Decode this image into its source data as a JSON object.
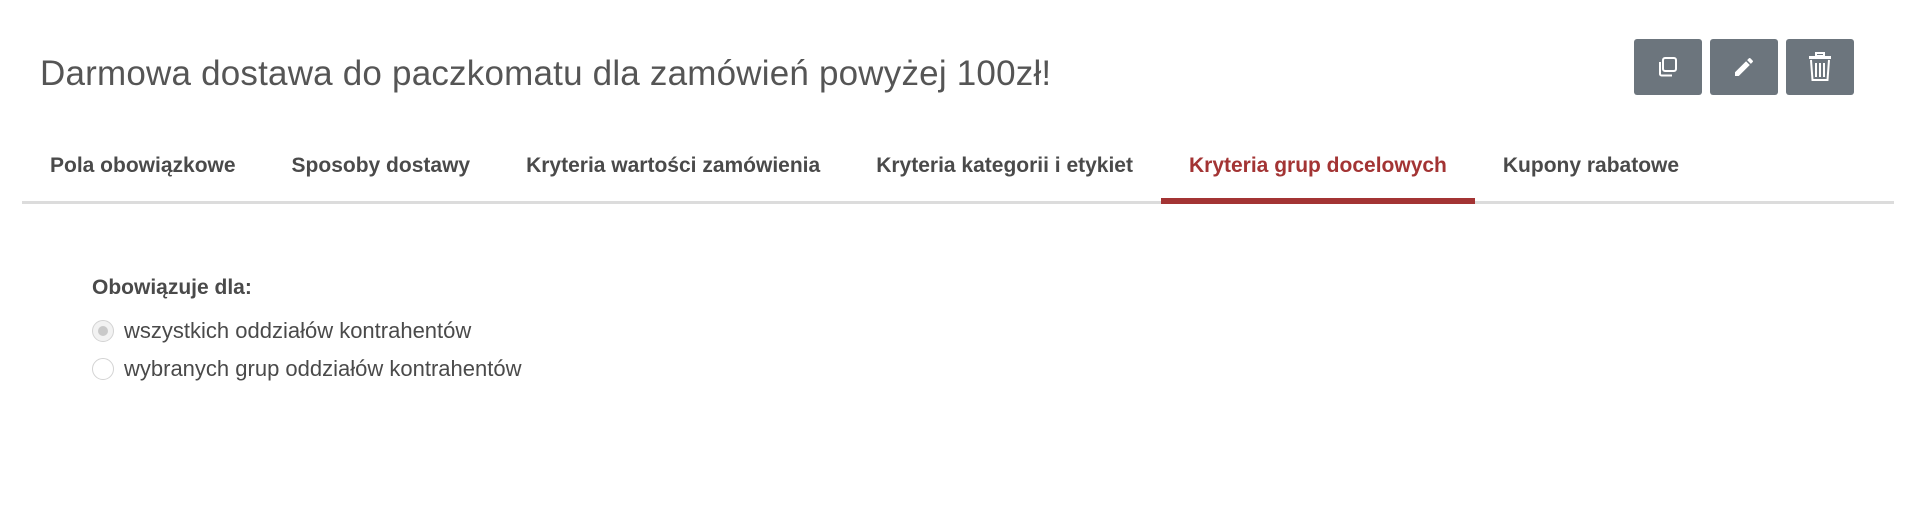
{
  "header": {
    "title": "Darmowa dostawa do paczkomatu dla zamówień powyżej 100zł!",
    "actions": [
      {
        "name": "copy-button",
        "icon": "copy-icon"
      },
      {
        "name": "edit-button",
        "icon": "pencil-icon"
      },
      {
        "name": "delete-button",
        "icon": "trash-icon"
      }
    ]
  },
  "tabs": [
    {
      "label": "Pola obowiązkowe",
      "active": false
    },
    {
      "label": "Sposoby dostawy",
      "active": false
    },
    {
      "label": "Kryteria wartości zamówienia",
      "active": false
    },
    {
      "label": "Kryteria kategorii i etykiet",
      "active": false
    },
    {
      "label": "Kryteria grup docelowych",
      "active": true
    },
    {
      "label": "Kupony rabatowe",
      "active": false
    }
  ],
  "form": {
    "label": "Obowiązuje dla:",
    "options": [
      {
        "label": "wszystkich oddziałów kontrahentów",
        "checked": true
      },
      {
        "label": "wybranych grup oddziałów kontrahentów",
        "checked": false
      }
    ]
  },
  "colors": {
    "accent": "#a33434",
    "button_bg": "#6c757d",
    "text": "#4a4a4a"
  }
}
